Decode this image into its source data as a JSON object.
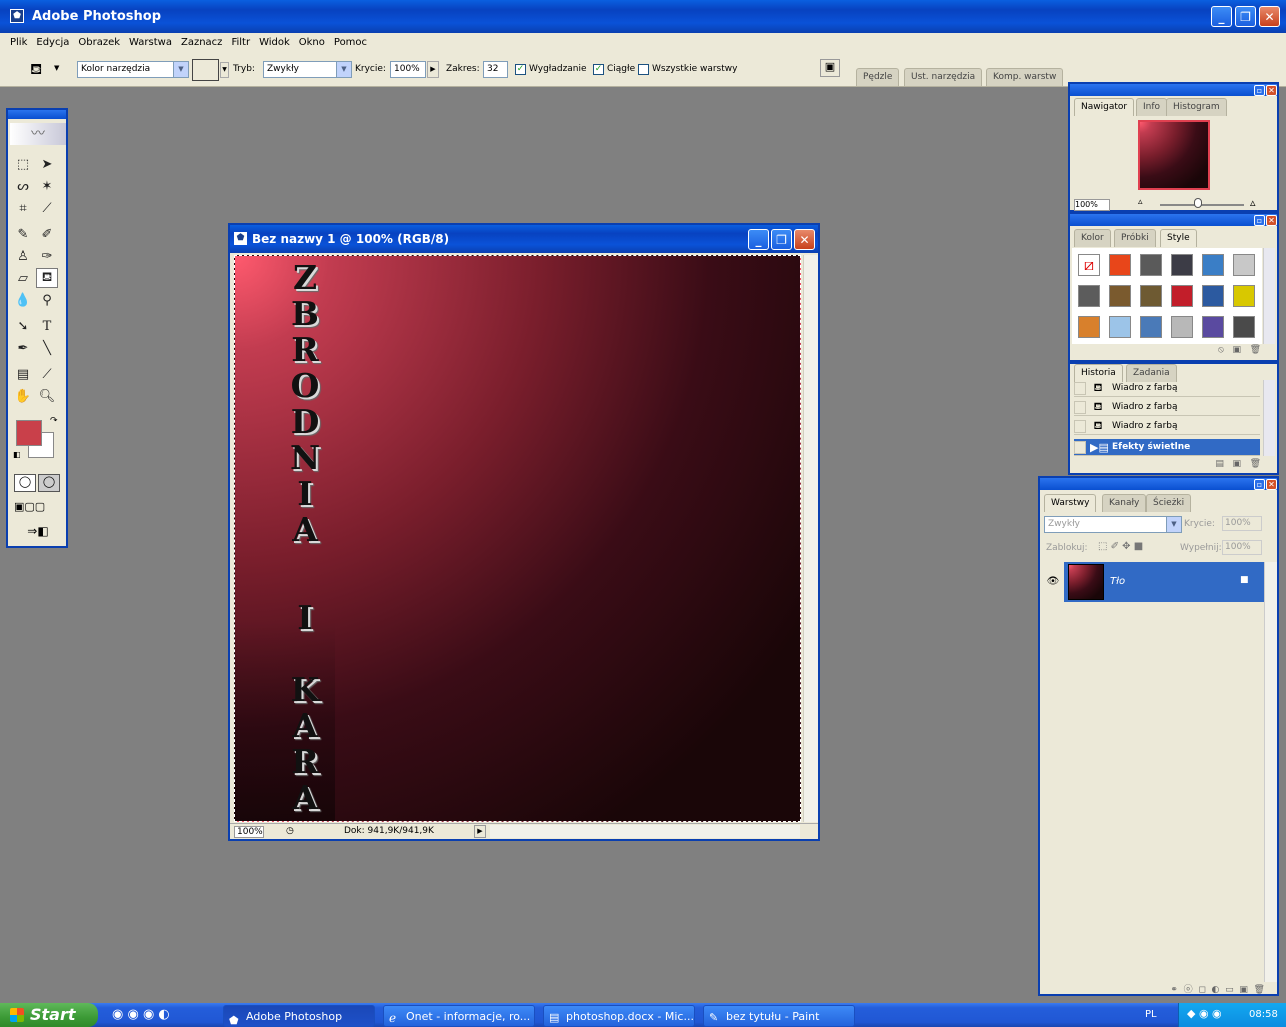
{
  "app": {
    "title": "Adobe Photoshop"
  },
  "menu": [
    "Plik",
    "Edycja",
    "Obrazek",
    "Warstwa",
    "Zaznacz",
    "Filtr",
    "Widok",
    "Okno",
    "Pomoc"
  ],
  "options": {
    "fill_source": "Kolor narzędzia",
    "mode_label": "Tryb:",
    "mode_value": "Zwykły",
    "opacity_label": "Krycie:",
    "opacity_value": "100%",
    "tolerance_label": "Zakres:",
    "tolerance_value": "32",
    "antialias_label": "Wygładzanie",
    "antialias_checked": true,
    "contiguous_label": "Ciągłe",
    "contiguous_checked": true,
    "all_layers_label": "Wszystkie warstwy",
    "all_layers_checked": false,
    "well_tabs": [
      "Pędzle",
      "Ust. narzędzia",
      "Komp. warstw"
    ]
  },
  "document": {
    "title": "Bez nazwy 1 @ 100% (RGB/8)",
    "zoom": "100%",
    "doc_size": "Dok: 941,9K/941,9K",
    "text_letters": [
      "Z",
      "B",
      "R",
      "O",
      "D",
      "N",
      "I",
      "A",
      "I",
      "K",
      "A",
      "R",
      "A"
    ]
  },
  "navigator": {
    "tabs": [
      "Nawigator",
      "Info",
      "Histogram"
    ],
    "zoom": "100%"
  },
  "swatches": {
    "tabs": [
      "Kolor",
      "Próbki",
      "Style"
    ],
    "styles": [
      "#ffffff",
      "#e8461a",
      "#5a5a5a",
      "#3c3c46",
      "#3a7ec6",
      "#c8c8c8",
      "#5c5c5c",
      "#7a5a2e",
      "#6e5a32",
      "#c21e2a",
      "#2c5aa0",
      "#d8c800",
      "#d8802c",
      "#9cc4e8",
      "#4a7ab8",
      "#b8b8b8",
      "#5a4aa0",
      "#4a4a4a"
    ]
  },
  "history": {
    "tabs": [
      "Historia",
      "Zadania"
    ],
    "items": [
      "Wiadro z farbą",
      "Wiadro z farbą",
      "Wiadro z farbą",
      "Efekty świetlne"
    ]
  },
  "layers": {
    "tabs": [
      "Warstwy",
      "Kanały",
      "Ścieżki"
    ],
    "blend_mode": "Zwykły",
    "opacity_label": "Krycie:",
    "opacity_value": "100%",
    "lock_label": "Zablokuj:",
    "fill_label": "Wypełnij:",
    "fill_value": "100%",
    "layer_name": "Tło"
  },
  "colors": {
    "foreground": "#c9404a",
    "background": "#ffffff"
  },
  "taskbar": {
    "start": "Start",
    "items": [
      "Adobe Photoshop",
      "Onet - informacje, ro...",
      "photoshop.docx - Mic...",
      "bez tytułu - Paint"
    ],
    "lang": "PL",
    "time": "08:58"
  }
}
